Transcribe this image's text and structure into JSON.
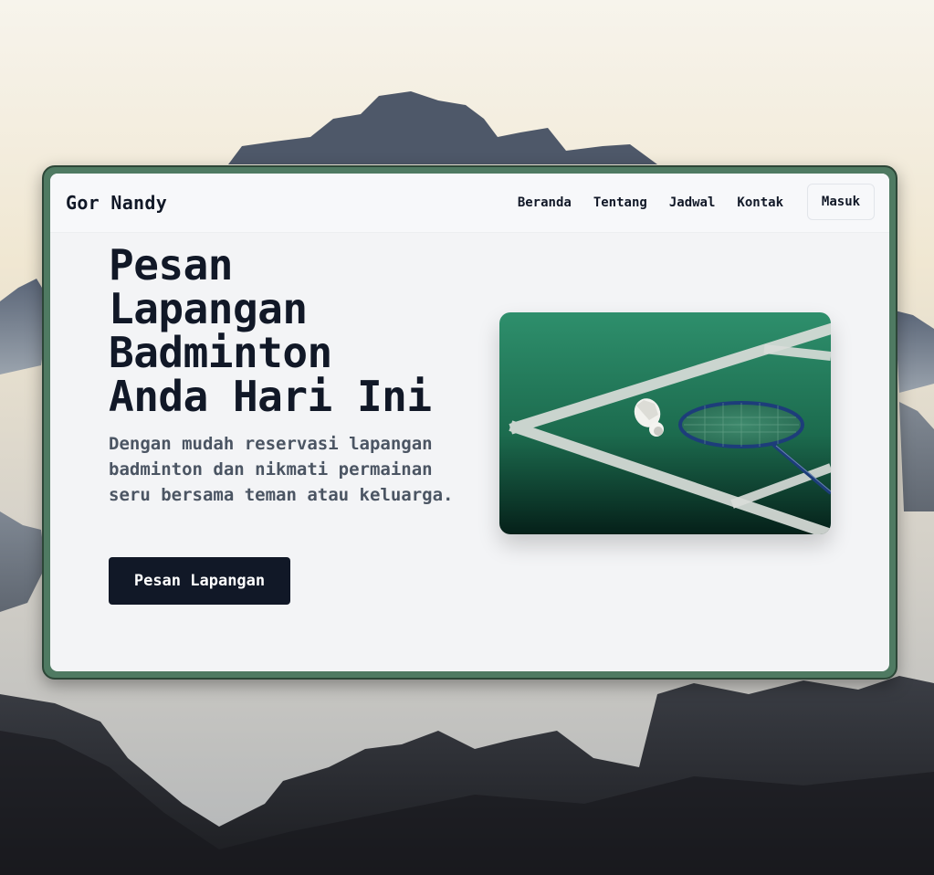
{
  "navbar": {
    "brand": "Gor Nandy",
    "links": [
      "Beranda",
      "Tentang",
      "Jadwal",
      "Kontak"
    ],
    "login_label": "Masuk"
  },
  "hero": {
    "title": "Pesan Lapangan Badminton Anda Hari Ini",
    "subtitle": "Dengan mudah reservasi lapangan badminton dan nikmati permainan seru bersama teman atau keluarga.",
    "cta_label": "Pesan Lapangan"
  },
  "colors": {
    "window_frame": "#4f7a62",
    "primary_button": "#111827",
    "court_green": "#1f7a5a"
  }
}
